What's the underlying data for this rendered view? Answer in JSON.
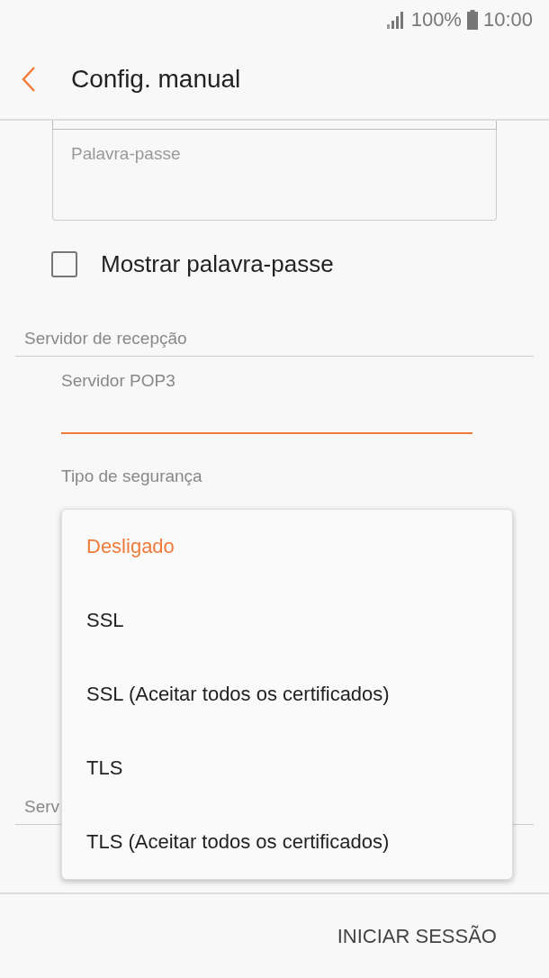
{
  "status_bar": {
    "battery": "100%",
    "time": "10:00"
  },
  "app_bar": {
    "title": "Config. manual"
  },
  "password_field": {
    "placeholder": "Palavra-passe"
  },
  "show_password": {
    "label": "Mostrar palavra-passe",
    "checked": false
  },
  "incoming_section": {
    "title": "Servidor de recepção",
    "server_field": {
      "placeholder": "Servidor POP3"
    },
    "security_label": "Tipo de segurança"
  },
  "outgoing_section": {
    "title": "Serv"
  },
  "security_menu": [
    {
      "label": "Desligado",
      "selected": true
    },
    {
      "label": "SSL",
      "selected": false
    },
    {
      "label": "SSL (Aceitar todos os certificados)",
      "selected": false
    },
    {
      "label": "TLS",
      "selected": false
    },
    {
      "label": "TLS (Aceitar todos os certificados)",
      "selected": false
    }
  ],
  "bottom_button": "INICIAR SESSÃO"
}
